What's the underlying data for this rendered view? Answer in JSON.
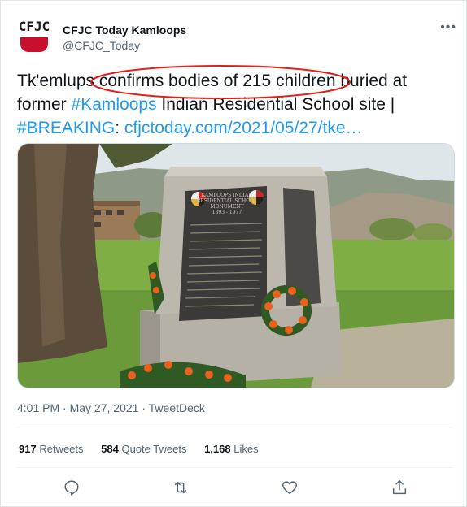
{
  "author": {
    "name": "CFJC Today Kamloops",
    "handle": "@CFJC_Today",
    "avatar_text": "CFJC"
  },
  "tweet": {
    "t1": "Tk'emlups confirms bodies of 215 children buried at former ",
    "hashtag1": "#Kamloops",
    "t2": " Indian Residential School site | ",
    "hashtag2": "#BREAKING",
    "t3": ": ",
    "link": "cfjctoday.com/2021/05/27/tke…"
  },
  "monument": {
    "line1": "KAMLOOPS INDIAN",
    "line2": "RESIDENTIAL SCHOOL",
    "line3": "MONUMENT",
    "line4": "1893 - 1977"
  },
  "meta": {
    "time": "4:01 PM",
    "sep": " · ",
    "date": "May 27, 2021",
    "source": "TweetDeck"
  },
  "stats": {
    "retweets_count": "917",
    "retweets_label": "Retweets",
    "quotes_count": "584",
    "quotes_label": "Quote Tweets",
    "likes_count": "1,168",
    "likes_label": "Likes"
  },
  "colors": {
    "link": "#1d9bf0",
    "annotation": "#e0201b",
    "brand": "#c8102e"
  },
  "icons": [
    "more-icon",
    "reply-icon",
    "retweet-icon",
    "like-icon",
    "share-icon"
  ]
}
